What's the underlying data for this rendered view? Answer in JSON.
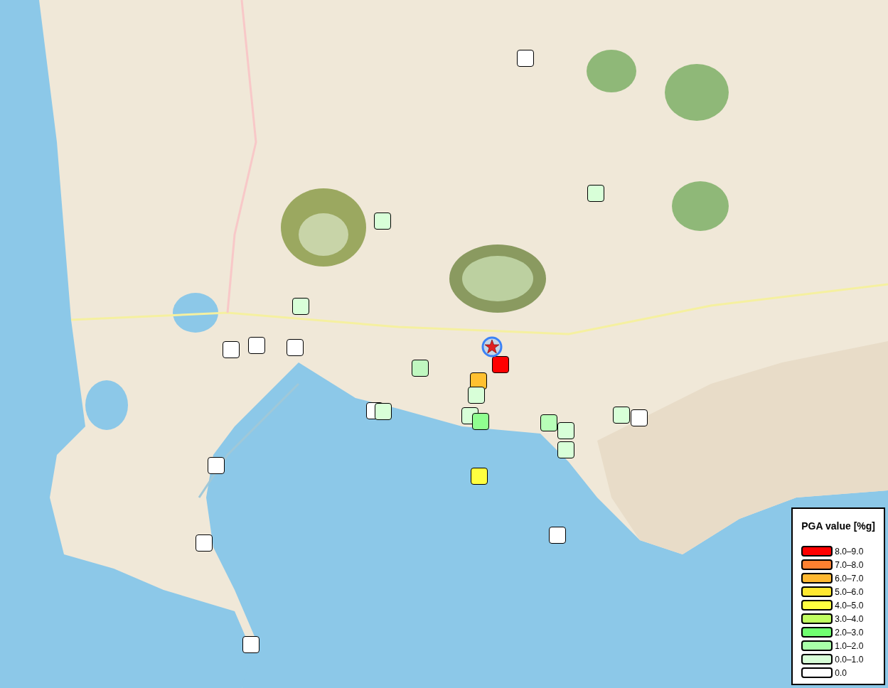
{
  "map": {
    "epicenter": {
      "kind": "star"
    },
    "stations": [
      {
        "color": "#ffffff"
      },
      {
        "color": "#d8ffd8"
      },
      {
        "color": "#d8ffd8"
      },
      {
        "color": "#d8ffd8"
      },
      {
        "color": "#ffffff"
      },
      {
        "color": "#ffffff"
      },
      {
        "color": "#ffffff"
      },
      {
        "color": "#c0f8c0"
      },
      {
        "color": "#ff0000"
      },
      {
        "color": "#ffc030"
      },
      {
        "color": "#d8ffd8"
      },
      {
        "color": "#ffffff"
      },
      {
        "color": "#d8ffd8"
      },
      {
        "color": "#d8ffd8"
      },
      {
        "color": "#90ff90"
      },
      {
        "color": "#b8ffb8"
      },
      {
        "color": "#d8ffd8"
      },
      {
        "color": "#d8ffd8"
      },
      {
        "color": "#d8ffd8"
      },
      {
        "color": "#ffffff"
      },
      {
        "color": "#ffffff"
      },
      {
        "color": "#ffff40"
      },
      {
        "color": "#ffffff"
      },
      {
        "color": "#ffffff"
      },
      {
        "color": "#ffffff"
      }
    ]
  },
  "legend": {
    "title": "PGA value [%g]",
    "entries": [
      {
        "label": "8.0–9.0",
        "color": "#ff0000"
      },
      {
        "label": "7.0–8.0",
        "color": "#ff8030"
      },
      {
        "label": "6.0–7.0",
        "color": "#ffb830"
      },
      {
        "label": "5.0–6.0",
        "color": "#ffe830"
      },
      {
        "label": "4.0–5.0",
        "color": "#ffff40"
      },
      {
        "label": "3.0–4.0",
        "color": "#c0ff60"
      },
      {
        "label": "2.0–3.0",
        "color": "#70ff70"
      },
      {
        "label": "1.0–2.0",
        "color": "#a8ffa8"
      },
      {
        "label": "0.0–1.0",
        "color": "#d8ffd8"
      },
      {
        "label": "0.0",
        "color": "#ffffff"
      }
    ]
  }
}
